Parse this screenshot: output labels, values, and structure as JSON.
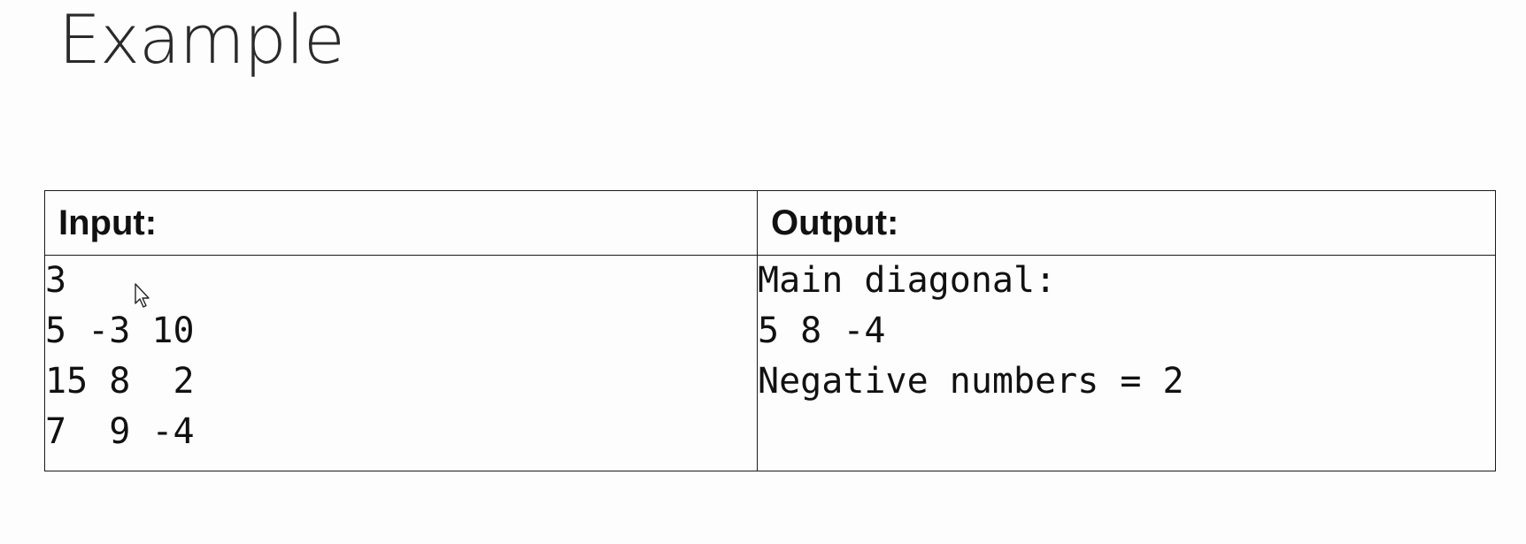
{
  "title": "Example",
  "table": {
    "input_header": "Input:",
    "output_header": "Output:",
    "input_lines": [
      "3",
      "5 -3 10",
      "15 8  2",
      "7  9 -4"
    ],
    "output_lines": [
      "Main diagonal:",
      "5 8 -4",
      "Negative numbers = 2"
    ]
  },
  "icons": {
    "cursor": "mouse-pointer-icon"
  }
}
